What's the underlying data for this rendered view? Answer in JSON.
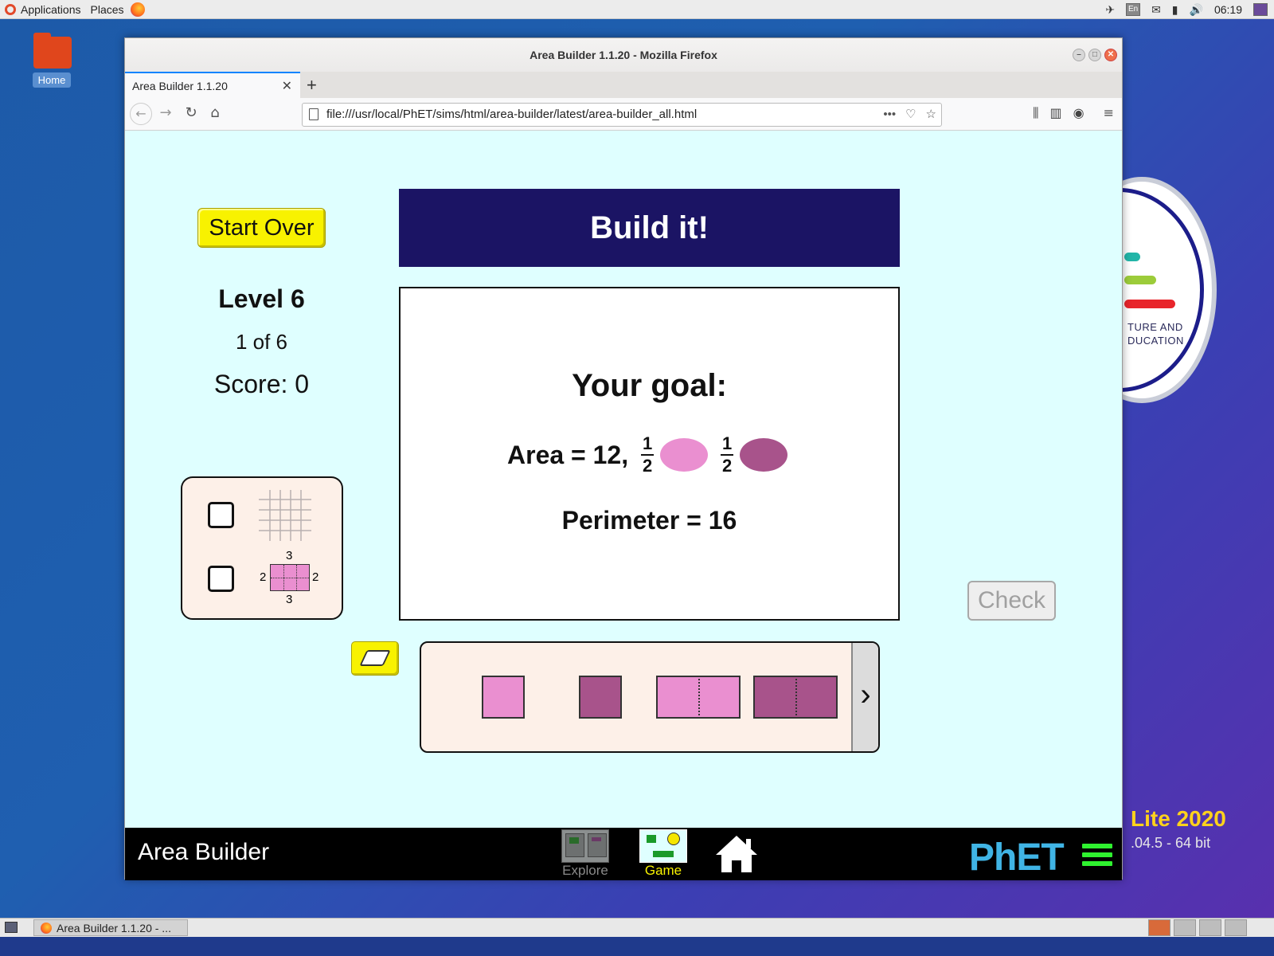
{
  "desktop": {
    "topbar": {
      "applications": "Applications",
      "places": "Places",
      "keyboard": "En",
      "clock": "06:19"
    },
    "home_label": "Home",
    "badge_text_1": "TURE AND",
    "badge_text_2": "DUCATION",
    "lite_title": "Lite 2020",
    "lite_sub": ".04.5 - 64 bit",
    "taskbar_item": "Area Builder 1.1.20 - ..."
  },
  "browser": {
    "window_title": "Area Builder 1.1.20 - Mozilla Firefox",
    "tab_title": "Area Builder 1.1.20",
    "url": "file:///usr/local/PhET/sims/html/area-builder/latest/area-builder_all.html"
  },
  "sim": {
    "start_over": "Start Over",
    "level": "Level 6",
    "progress": "1 of 6",
    "score": "Score: 0",
    "banner": "Build it!",
    "goal_title": "Your goal:",
    "area_text": "Area = 12,",
    "fraction_num": "1",
    "fraction_den": "2",
    "perimeter_text": "Perimeter = 16",
    "check": "Check",
    "dim_labels": {
      "top": "3",
      "bottom": "3",
      "left": "2",
      "right": "2"
    },
    "app_title": "Area Builder",
    "screens": {
      "explore": "Explore",
      "game": "Game"
    },
    "phet_logo": "PhET",
    "colors": {
      "light_pink": "#ea8fd0",
      "dark_purple": "#a8538b",
      "banner": "#1b1464",
      "sim_bg": "#dfffff"
    }
  }
}
